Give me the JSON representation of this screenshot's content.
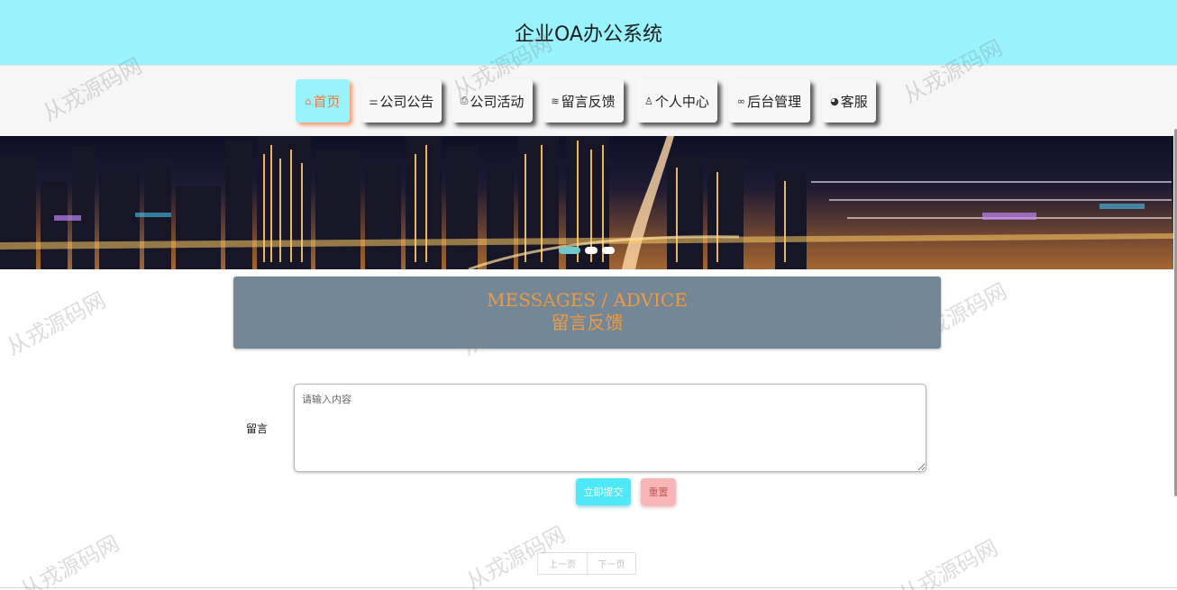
{
  "header": {
    "title": "企业OA办公系统"
  },
  "nav": {
    "items": [
      {
        "icon": "home-icon",
        "glyph": "⌂",
        "label": "首页",
        "active": true
      },
      {
        "icon": "sliders-icon",
        "glyph": "⚌",
        "label": "公司公告",
        "active": false
      },
      {
        "icon": "printer-icon",
        "glyph": "⎙",
        "label": "公司活动",
        "active": false
      },
      {
        "icon": "layers-icon",
        "glyph": "≋",
        "label": "留言反馈",
        "active": false
      },
      {
        "icon": "user-icon",
        "glyph": "♙",
        "label": "个人中心",
        "active": false
      },
      {
        "icon": "link-icon",
        "glyph": "∞",
        "label": "后台管理",
        "active": false
      },
      {
        "icon": "service-icon",
        "glyph": "◕",
        "label": "客服",
        "active": false
      }
    ]
  },
  "carousel": {
    "slide_count": 3,
    "active_index": 0
  },
  "section": {
    "title_en": "MESSAGES / ADVICE",
    "title_cn": "留言反馈"
  },
  "form": {
    "label": "留言",
    "placeholder": "请输入内容",
    "value": "",
    "submit_label": "立即提交",
    "reset_label": "重置"
  },
  "pagination": {
    "prev_label": "上一页",
    "next_label": "下一页"
  },
  "watermark": {
    "text": "从戎源码网"
  },
  "colors": {
    "header_bg": "#98f3fc",
    "nav_active_text": "#f17a3c",
    "section_bg": "#738797",
    "section_text": "#ec9a44",
    "submit_bg": "#4fe8f8",
    "reset_bg": "#f7b5b5"
  }
}
